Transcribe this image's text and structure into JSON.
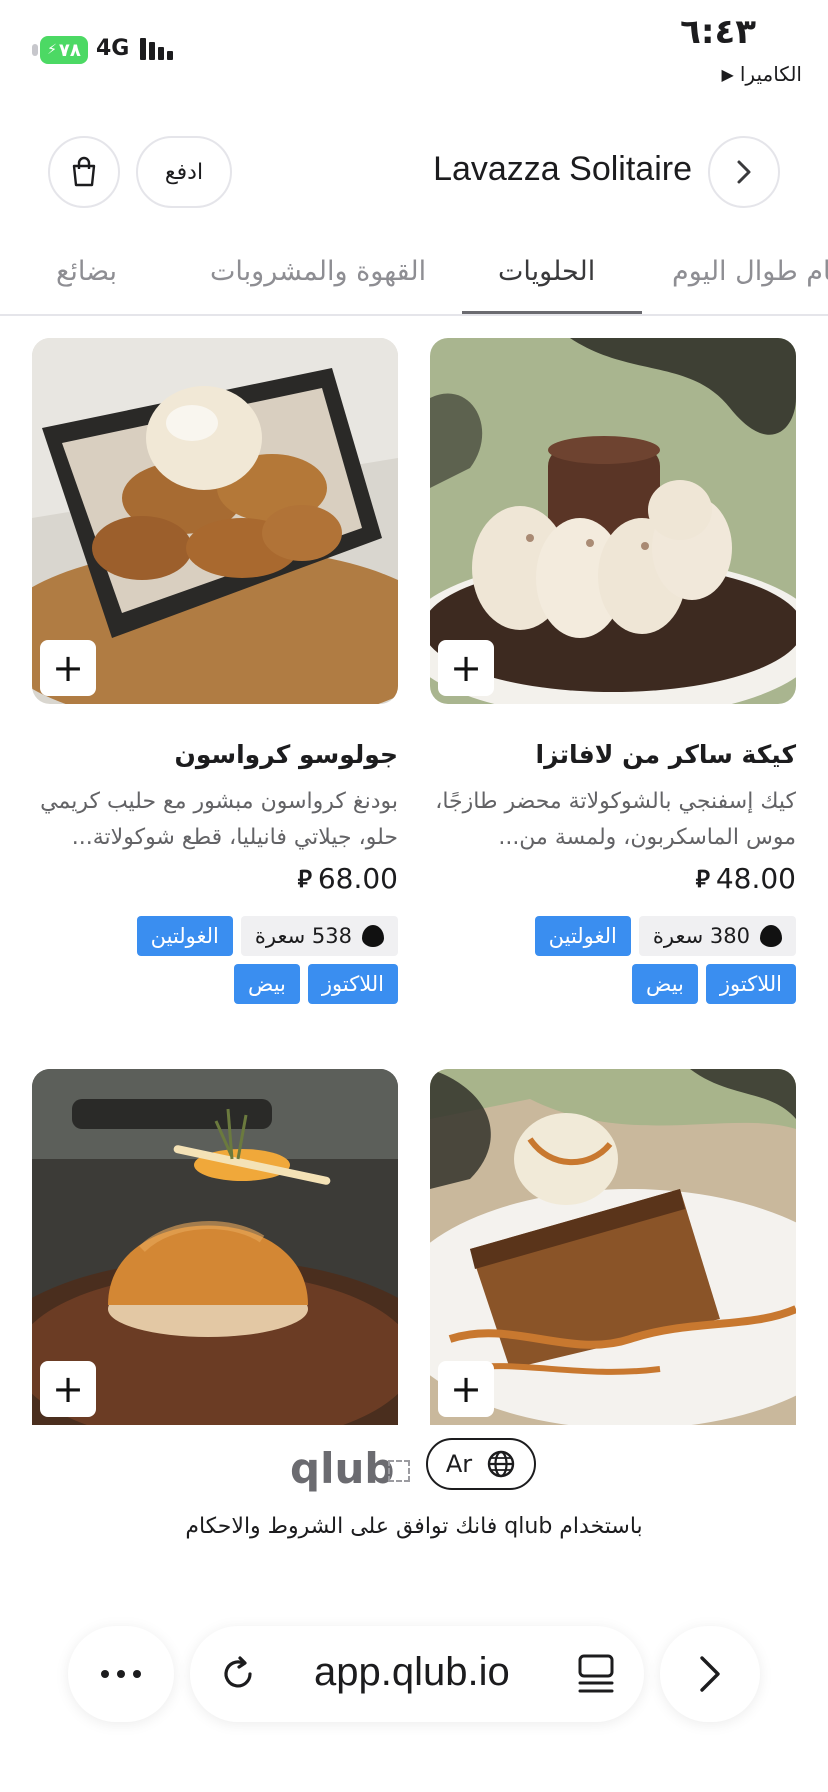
{
  "status_bar": {
    "battery": "٧٨",
    "network": "4G",
    "time": "٦:٤٣",
    "back_app": "الكاميرا"
  },
  "header": {
    "store_name": "Lavazza Solitaire",
    "pay_label": "ادفع"
  },
  "tabs": [
    {
      "label": "بضائع",
      "active": false
    },
    {
      "label": "القهوة والمشروبات",
      "active": false
    },
    {
      "label": "الحلويات",
      "active": true
    },
    {
      "label": "طعام طوال اليوم",
      "active": false
    }
  ],
  "products": [
    {
      "name": "كيكة ساكر من لافاتزا",
      "description": "كيك إسفنجي بالشوكولاتة محضر طازجًا، موس الماسكربون، ولمسة من...",
      "price": "48.00",
      "calories": "380 سعرة",
      "allergens": [
        "الغولتين",
        "اللاكتوز",
        "بيض"
      ]
    },
    {
      "name": "جولوسو كرواسون",
      "description": "بودنغ كرواسون مبشور مع حليب كريمي حلو، جيلاتي فانيليا، قطع شوكولاتة...",
      "price": "68.00",
      "calories": "538 سعرة",
      "allergens": [
        "الغولتين",
        "اللاكتوز",
        "بيض"
      ]
    }
  ],
  "add_label": "+",
  "footer": {
    "brand": "qlub",
    "lang": "Ar",
    "terms": "باستخدام qlub فانك توافق على  الشروط والاحكام"
  },
  "browser": {
    "url": "app.qlub.io"
  },
  "colors": {
    "tag_blue": "#3a8ef0",
    "battery_green": "#4cd964"
  }
}
